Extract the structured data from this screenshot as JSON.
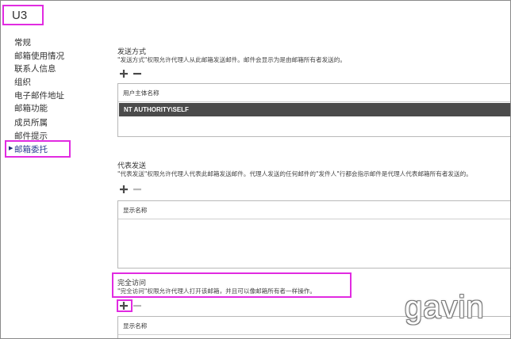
{
  "window": {
    "title": "U3"
  },
  "nav": {
    "items": [
      {
        "label": "常规"
      },
      {
        "label": "邮箱使用情况"
      },
      {
        "label": "联系人信息"
      },
      {
        "label": "组织"
      },
      {
        "label": "电子邮件地址"
      },
      {
        "label": "邮箱功能"
      },
      {
        "label": "成员所属"
      },
      {
        "label": "邮件提示"
      },
      {
        "label": "邮箱委托",
        "selected": true
      }
    ]
  },
  "send_as": {
    "heading": "发送方式",
    "description": "\"发送方式\"权限允许代理人从此邮箱发送邮件。邮件会显示为是由邮箱所有者发送的。",
    "column_header": "用户主体名称",
    "entries": [
      "NT AUTHORITY\\SELF"
    ]
  },
  "send_on_behalf": {
    "heading": "代表发送",
    "description": "\"代表发送\"权限允许代理人代表此邮箱发送邮件。代理人发送的任何邮件的\"发件人\"行都会指示邮件是代理人代表邮箱所有者发送的。",
    "column_header": "显示名称"
  },
  "full_access": {
    "heading": "完全访问",
    "description": "\"完全访问\"权限允许代理人打开该邮箱，并且可以像邮箱所有者一样操作。",
    "column_header": "显示名称"
  },
  "icons": {
    "add": "plus-icon",
    "remove": "minus-icon",
    "selected_nav": "triangle-right-icon"
  },
  "colors": {
    "highlight_box": "#e12be1",
    "selected_row": "#4b4b4b",
    "nav_selected": "#2a3c8f"
  },
  "watermark": "gavin"
}
